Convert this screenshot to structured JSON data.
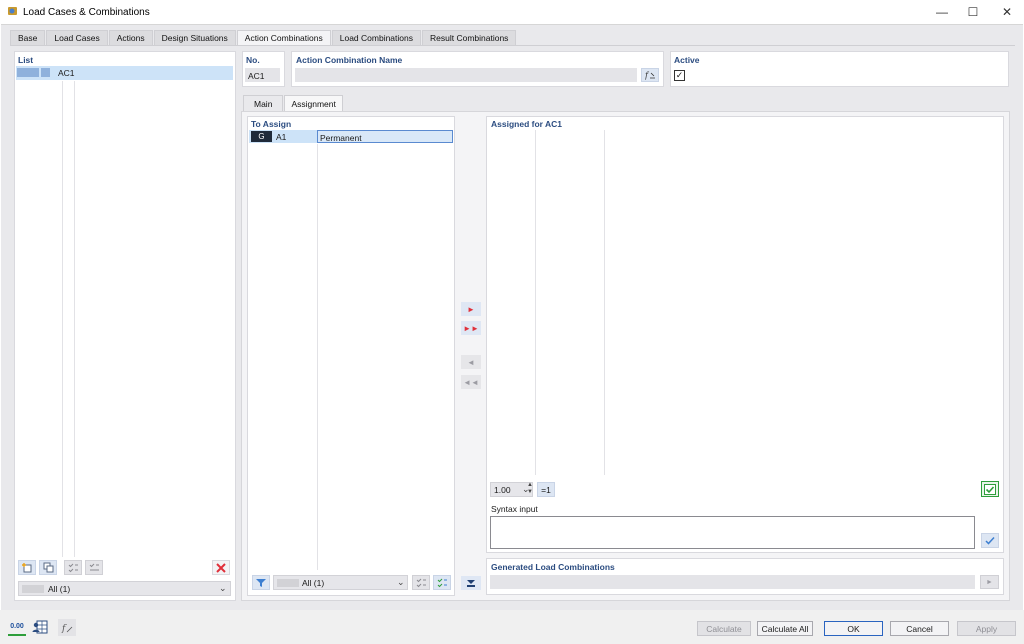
{
  "window": {
    "title": "Load Cases & Combinations",
    "minimize_glyph": "—",
    "maximize_glyph": "☐",
    "close_glyph": "✕"
  },
  "tabs": [
    {
      "label": "Base",
      "active": false
    },
    {
      "label": "Load Cases",
      "active": false
    },
    {
      "label": "Actions",
      "active": false
    },
    {
      "label": "Design Situations",
      "active": false
    },
    {
      "label": "Action Combinations",
      "active": true
    },
    {
      "label": "Load Combinations",
      "active": false
    },
    {
      "label": "Result Combinations",
      "active": false
    }
  ],
  "list_panel": {
    "label": "List",
    "items": [
      {
        "label": "AC1",
        "swatch_color": "#8fb1dc"
      }
    ],
    "filter_value": "All (1)"
  },
  "header": {
    "no_label": "No.",
    "no_value": "AC1",
    "name_label": "Action Combination Name",
    "name_value": "",
    "active_label": "Active",
    "active_checked": true
  },
  "subtabs": [
    {
      "label": "Main",
      "active": false
    },
    {
      "label": "Assignment",
      "active": true
    }
  ],
  "to_assign": {
    "label": "To Assign",
    "rows": [
      {
        "badge": "G",
        "id": "A1",
        "name": "Permanent"
      }
    ],
    "filter_value": "All (1)"
  },
  "assigned": {
    "label": "Assigned for AC1",
    "factor": "1.00",
    "eq_label": "=1",
    "syntax_label": "Syntax input",
    "syntax_value": ""
  },
  "generated": {
    "label": "Generated Load Combinations",
    "value": ""
  },
  "footer": {
    "calculate": "Calculate",
    "calculate_all": "Calculate All",
    "ok": "OK",
    "cancel": "Cancel",
    "apply": "Apply",
    "units_icon_text": "0.00"
  },
  "colors": {
    "accent": "#2b4c80",
    "selection": "#cde3f8",
    "badge_bg": "#1f2a3a",
    "delete_red": "#e0303a",
    "check_green": "#2e9e3b"
  }
}
